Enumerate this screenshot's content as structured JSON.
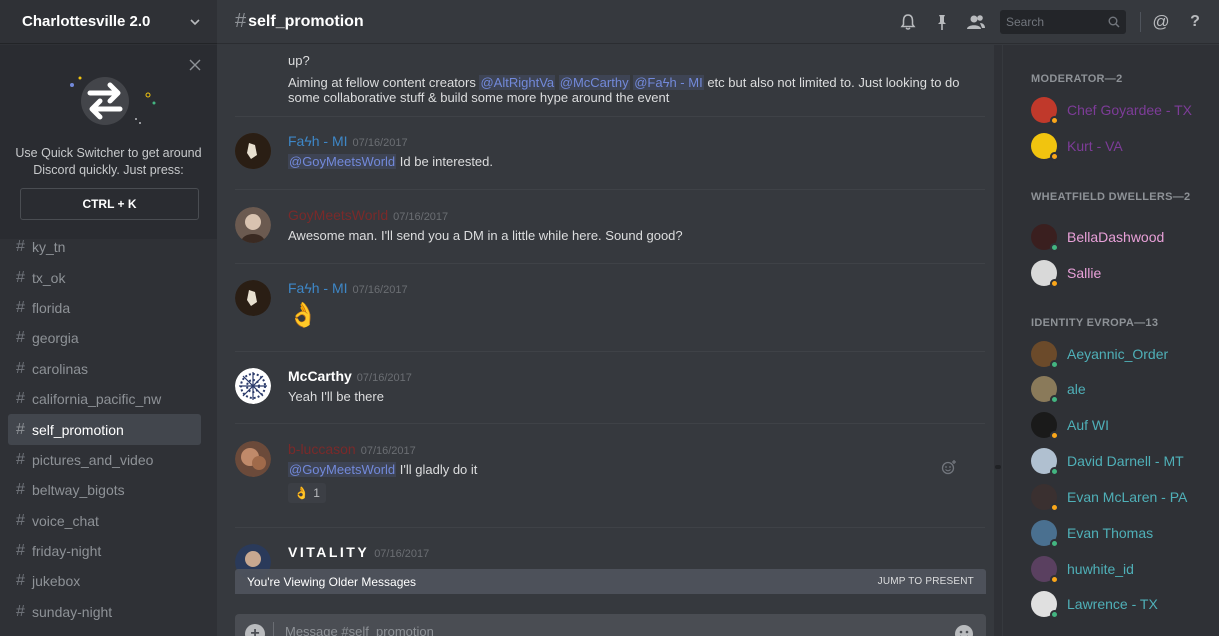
{
  "guild": {
    "name": "Charlottesville 2.0"
  },
  "switcher": {
    "tip": "Use Quick Switcher to get around Discord quickly. Just press:",
    "shortcut": "CTRL + K"
  },
  "channels": [
    {
      "name": "ky_tn"
    },
    {
      "name": "tx_ok"
    },
    {
      "name": "florida"
    },
    {
      "name": "georgia"
    },
    {
      "name": "carolinas"
    },
    {
      "name": "california_pacific_nw"
    },
    {
      "name": "self_promotion",
      "active": true
    },
    {
      "name": "pictures_and_video"
    },
    {
      "name": "beltway_bigots"
    },
    {
      "name": "voice_chat"
    },
    {
      "name": "friday-night"
    },
    {
      "name": "jukebox"
    },
    {
      "name": "sunday-night"
    }
  ],
  "header": {
    "hash": "#",
    "channel": "self_promotion",
    "search_placeholder": "Search",
    "icons": [
      "bell-icon",
      "pin-icon",
      "members-icon",
      "search-icon",
      "at-icon",
      "help-icon"
    ]
  },
  "messages": {
    "top_fragment": {
      "line1": "up?",
      "line2_prefix": "Aiming at fellow content creators ",
      "mentions": [
        "@AltRightVa",
        "@McCarthy",
        "@Faϟh - MI"
      ],
      "line2_suffix": " etc but also not limited to. Just looking to do some collaborative stuff & build some more hype around the event"
    },
    "items": [
      {
        "author": "Faϟh - MI",
        "color": "#3e87c7",
        "timestamp": "07/16/2017",
        "mention": "@GoyMeetsWorld",
        "text": " Id be interested."
      },
      {
        "author": "GoyMeetsWorld",
        "color": "#7a2a2a",
        "timestamp": "07/16/2017",
        "text": "Awesome man. I'll send you a DM in a little while here. Sound good?"
      },
      {
        "author": "Faϟh - MI",
        "color": "#3e87c7",
        "timestamp": "07/16/2017",
        "emoji": "👌"
      },
      {
        "author": "McCarthy",
        "color": "#ffffff",
        "timestamp": "07/16/2017",
        "text": "Yeah I'll be there"
      },
      {
        "author": "b-luccason",
        "color": "#7a2a2a",
        "timestamp": "07/16/2017",
        "mention": "@GoyMeetsWorld",
        "text": " I'll gladly do it",
        "reaction": {
          "emoji": "👌",
          "count": "1"
        }
      },
      {
        "author": "VITALITY",
        "color": "#ffffff",
        "timestamp": "07/16/2017"
      }
    ]
  },
  "older_bar": {
    "text": "You're Viewing Older Messages",
    "jump": "JUMP TO PRESENT"
  },
  "composer": {
    "placeholder": "Message #self_promotion"
  },
  "members": {
    "groups": [
      {
        "title": "MODERATOR—2",
        "members": [
          {
            "name": "Chef Goyardee - TX",
            "color": "#7d3c98",
            "status": "#faa61a",
            "avatar": "#c0392b"
          },
          {
            "name": "Kurt - VA",
            "color": "#7d3c98",
            "status": "#faa61a",
            "avatar": "#f1c40f"
          }
        ]
      },
      {
        "title": "WHEATFIELD DWELLERS—2",
        "members": [
          {
            "name": "BellaDashwood",
            "color": "#e8a0d8",
            "status": "#43b581",
            "avatar": "#3a1f1f"
          },
          {
            "name": "Sallie",
            "color": "#e8a0d8",
            "status": "#faa61a",
            "avatar": "#d9d9d9"
          }
        ]
      },
      {
        "title": "IDENTITY EVROPA—13",
        "members": [
          {
            "name": "Aeyannic_Order",
            "color": "#4fb0b8",
            "status": "#43b581",
            "avatar": "#6b4a2a"
          },
          {
            "name": "ale",
            "color": "#4fb0b8",
            "status": "#43b581",
            "avatar": "#8a7a5a"
          },
          {
            "name": "Auf WI",
            "color": "#4fb0b8",
            "status": "#faa61a",
            "avatar": "#1a1a1a"
          },
          {
            "name": "David Darnell - MT",
            "color": "#4fb0b8",
            "status": "#43b581",
            "avatar": "#b0c0d0"
          },
          {
            "name": "Evan McLaren - PA",
            "color": "#4fb0b8",
            "status": "#faa61a",
            "avatar": "#3a3030"
          },
          {
            "name": "Evan Thomas",
            "color": "#4fb0b8",
            "status": "#43b581",
            "avatar": "#4a7090"
          },
          {
            "name": "huwhite_id",
            "color": "#4fb0b8",
            "status": "#faa61a",
            "avatar": "#5a4060"
          },
          {
            "name": "Lawrence - TX",
            "color": "#4fb0b8",
            "status": "#43b581",
            "avatar": "#e0e0e0"
          }
        ]
      }
    ]
  }
}
